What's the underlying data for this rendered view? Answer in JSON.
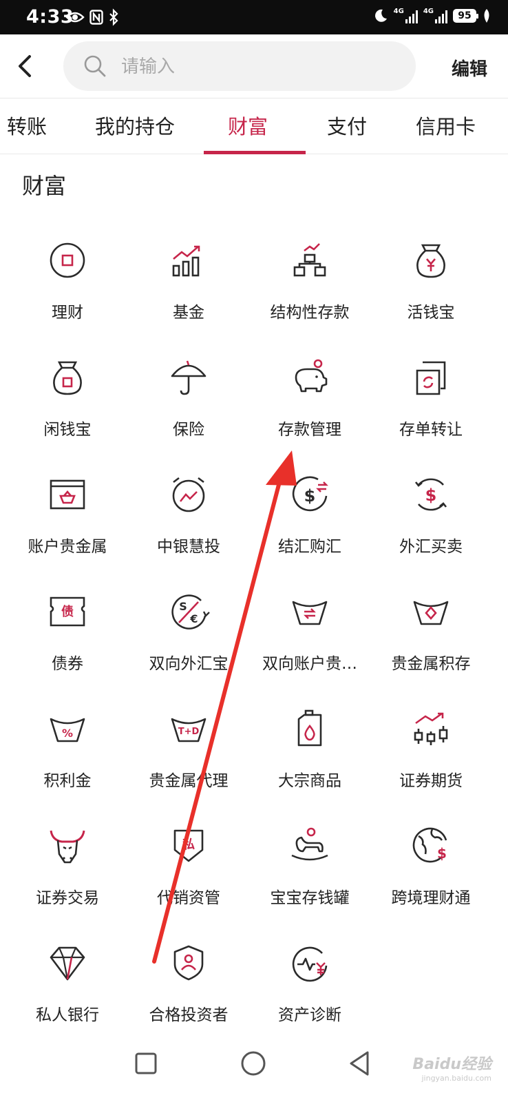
{
  "status_bar": {
    "time": "4:33",
    "net1": "4G",
    "net2": "4G",
    "battery": "95"
  },
  "header": {
    "search_placeholder": "请输入",
    "edit_label": "编辑"
  },
  "tabs": [
    {
      "label": "转账",
      "active": false
    },
    {
      "label": "我的持仓",
      "active": false
    },
    {
      "label": "财富",
      "active": true
    },
    {
      "label": "支付",
      "active": false
    },
    {
      "label": "信用卡",
      "active": false
    }
  ],
  "section": {
    "title": "财富"
  },
  "items": [
    {
      "label": "理财",
      "icon": "wealth-coin-icon"
    },
    {
      "label": "基金",
      "icon": "fund-bar-chart-icon"
    },
    {
      "label": "结构性存款",
      "icon": "structured-deposit-icon"
    },
    {
      "label": "活钱宝",
      "icon": "money-bag-yen-icon"
    },
    {
      "label": "闲钱宝",
      "icon": "money-bag-icon"
    },
    {
      "label": "保险",
      "icon": "umbrella-icon"
    },
    {
      "label": "存款管理",
      "icon": "piggy-bank-icon"
    },
    {
      "label": "存单转让",
      "icon": "certificate-transfer-icon"
    },
    {
      "label": "账户贵金属",
      "icon": "precious-metal-box-icon"
    },
    {
      "label": "中银慧投",
      "icon": "alarm-chart-icon"
    },
    {
      "label": "结汇购汇",
      "icon": "exchange-dollar-icon"
    },
    {
      "label": "外汇买卖",
      "icon": "dollar-cycle-icon"
    },
    {
      "label": "债券",
      "icon": "bond-ticket-icon"
    },
    {
      "label": "双向外汇宝",
      "icon": "dollar-euro-icon"
    },
    {
      "label": "双向账户贵…",
      "icon": "ingot-exchange-icon"
    },
    {
      "label": "贵金属积存",
      "icon": "ingot-diamond-icon"
    },
    {
      "label": "积利金",
      "icon": "ingot-percent-icon"
    },
    {
      "label": "贵金属代理",
      "icon": "ingot-td-icon"
    },
    {
      "label": "大宗商品",
      "icon": "oil-can-icon"
    },
    {
      "label": "证券期货",
      "icon": "candlestick-icon"
    },
    {
      "label": "证券交易",
      "icon": "bull-icon"
    },
    {
      "label": "代销资管",
      "icon": "private-shield-icon"
    },
    {
      "label": "宝宝存钱罐",
      "icon": "rocking-horse-icon"
    },
    {
      "label": "跨境理财通",
      "icon": "globe-dollar-icon"
    },
    {
      "label": "私人银行",
      "icon": "diamond-icon"
    },
    {
      "label": "合格投资者",
      "icon": "investor-shield-icon"
    },
    {
      "label": "资产诊断",
      "icon": "asset-diagnosis-icon"
    }
  ],
  "watermark": {
    "text": "Baidu经验",
    "sub": "jingyan.baidu.com"
  },
  "colors": {
    "accent": "#c6254a",
    "icon_dark": "#2b2b2b"
  }
}
